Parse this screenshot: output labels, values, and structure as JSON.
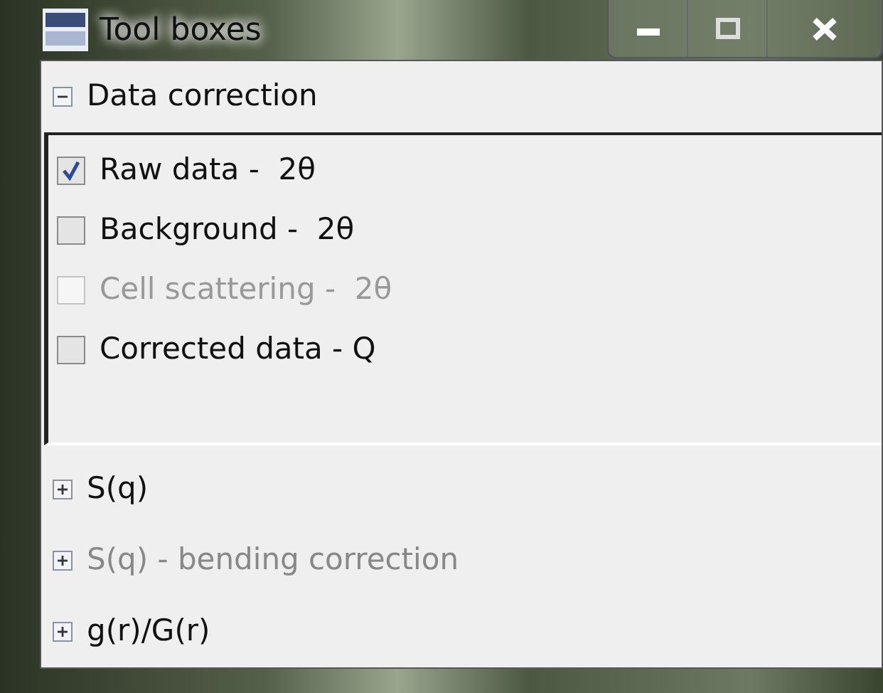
{
  "window": {
    "title": "Tool boxes",
    "buttons": [
      {
        "kind": "minimize"
      },
      {
        "kind": "maximize"
      },
      {
        "kind": "close"
      }
    ]
  },
  "sections": [
    {
      "title": "Data correction",
      "expanded": true,
      "disabled": false,
      "items": [
        {
          "label": "Raw data -  2θ",
          "checked": true,
          "disabled": false
        },
        {
          "label": "Background -  2θ",
          "checked": false,
          "disabled": false
        },
        {
          "label": "Cell scattering -  2θ",
          "checked": false,
          "disabled": true
        },
        {
          "label": "Corrected data - Q",
          "checked": false,
          "disabled": false
        }
      ]
    },
    {
      "title": "S(q)",
      "expanded": false,
      "disabled": false
    },
    {
      "title": "S(q) - bending correction",
      "expanded": false,
      "disabled": true
    },
    {
      "title": "g(r)/G(r)",
      "expanded": false,
      "disabled": false
    }
  ]
}
